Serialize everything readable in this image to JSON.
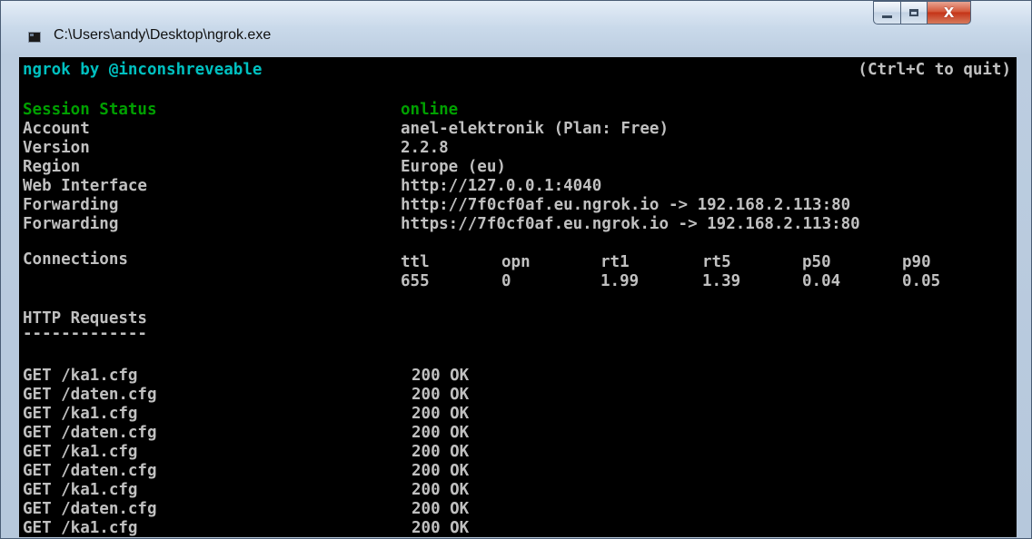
{
  "window": {
    "title": "C:\\Users\\andy\\Desktop\\ngrok.exe"
  },
  "header": {
    "brand": "ngrok by @inconshreveable",
    "quit_hint": "(Ctrl+C to quit)"
  },
  "status": [
    {
      "label": "Session Status",
      "value": "online"
    },
    {
      "label": "Account",
      "value": "anel-elektronik (Plan: Free)"
    },
    {
      "label": "Version",
      "value": "2.2.8"
    },
    {
      "label": "Region",
      "value": "Europe (eu)"
    },
    {
      "label": "Web Interface",
      "value": "http://127.0.0.1:4040"
    },
    {
      "label": "Forwarding",
      "value": "http://7f0cf0af.eu.ngrok.io -> 192.168.2.113:80"
    },
    {
      "label": "Forwarding",
      "value": "https://7f0cf0af.eu.ngrok.io -> 192.168.2.113:80"
    }
  ],
  "connections": {
    "label": "Connections",
    "columns": [
      {
        "header": "ttl",
        "value": "655"
      },
      {
        "header": "opn",
        "value": "0"
      },
      {
        "header": "rt1",
        "value": "1.99"
      },
      {
        "header": "rt5",
        "value": "1.39"
      },
      {
        "header": "p50",
        "value": "0.04"
      },
      {
        "header": "p90",
        "value": "0.05"
      }
    ]
  },
  "http_requests": {
    "title": "HTTP Requests",
    "underline": "-------------",
    "rows": [
      {
        "request": "GET /ka1.cfg",
        "status": "200 OK"
      },
      {
        "request": "GET /daten.cfg",
        "status": "200 OK"
      },
      {
        "request": "GET /ka1.cfg",
        "status": "200 OK"
      },
      {
        "request": "GET /daten.cfg",
        "status": "200 OK"
      },
      {
        "request": "GET /ka1.cfg",
        "status": "200 OK"
      },
      {
        "request": "GET /daten.cfg",
        "status": "200 OK"
      },
      {
        "request": "GET /ka1.cfg",
        "status": "200 OK"
      },
      {
        "request": "GET /daten.cfg",
        "status": "200 OK"
      },
      {
        "request": "GET /ka1.cfg",
        "status": "200 OK"
      }
    ]
  },
  "colors": {
    "console_bg": "#000000",
    "text": "#c0c0c0",
    "brand": "#00c0c0",
    "online": "#00a000"
  }
}
